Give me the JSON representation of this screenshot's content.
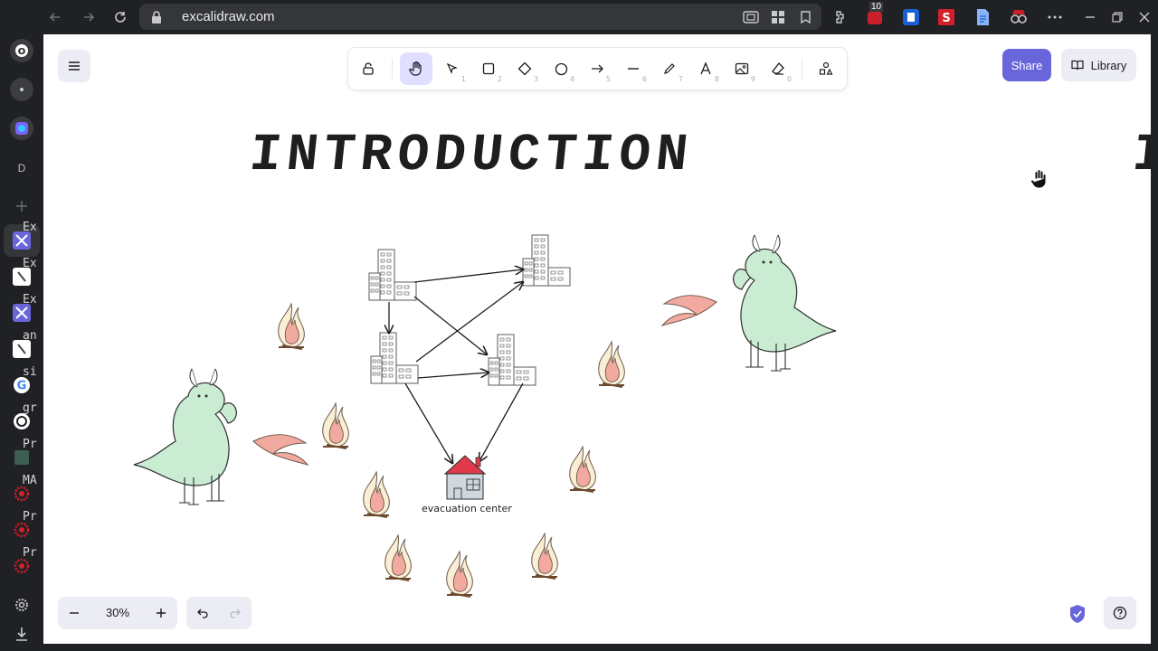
{
  "browser": {
    "url": "excalidraw.com",
    "extension_badge": "10"
  },
  "sidebar": {
    "top_items": [
      {
        "icon": "opera-logo-icon"
      },
      {
        "icon": "dot-icon"
      },
      {
        "icon": "app-icon"
      },
      {
        "label": "D"
      },
      {
        "icon": "plus-icon"
      }
    ],
    "tabs": [
      {
        "label": "Ex",
        "icon": "excalidraw-icon"
      },
      {
        "label": "Ex",
        "icon": "excalidraw-white-icon"
      },
      {
        "label": "Ex",
        "icon": "excalidraw-icon"
      },
      {
        "label": "an",
        "icon": "excalidraw-white-icon"
      },
      {
        "label": "si",
        "icon": "google-icon"
      },
      {
        "label": "gr",
        "icon": "chatgpt-icon"
      },
      {
        "label": "Pr",
        "icon": "green-square-icon"
      },
      {
        "label": "MA",
        "icon": "red-gear-icon"
      },
      {
        "label": "Pr",
        "icon": "red-gear-icon"
      },
      {
        "label": "Pr",
        "icon": "red-gear-icon"
      }
    ]
  },
  "toolbar": {
    "tools": [
      {
        "name": "lock",
        "key": ""
      },
      {
        "name": "hand",
        "key": ""
      },
      {
        "name": "selection",
        "key": "1"
      },
      {
        "name": "rectangle",
        "key": "2"
      },
      {
        "name": "diamond",
        "key": "3"
      },
      {
        "name": "ellipse",
        "key": "4"
      },
      {
        "name": "arrow",
        "key": "5"
      },
      {
        "name": "line",
        "key": "6"
      },
      {
        "name": "draw",
        "key": "7"
      },
      {
        "name": "text",
        "key": "8"
      },
      {
        "name": "image",
        "key": "9"
      },
      {
        "name": "eraser",
        "key": "0"
      },
      {
        "name": "more-tools",
        "key": ""
      }
    ]
  },
  "header": {
    "share_label": "Share",
    "library_label": "Library"
  },
  "footer": {
    "zoom": "30%"
  },
  "canvas": {
    "title": "INTRODUCTION",
    "title_partial": "I",
    "house_label": "evacuation center"
  },
  "colors": {
    "accent": "#6965db",
    "dragon_fill": "#c9ecd2",
    "flame_fill": "#f2a9a0",
    "house_roof": "#e03a4b"
  }
}
